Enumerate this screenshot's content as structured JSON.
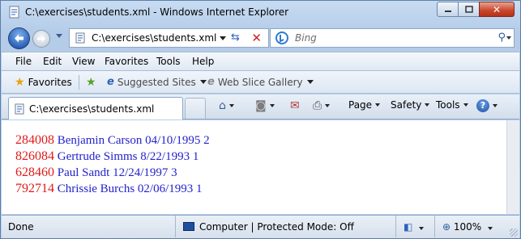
{
  "window": {
    "title": "C:\\exercises\\students.xml - Windows Internet Explorer",
    "controls": {
      "close_glyph": "✕"
    }
  },
  "navigation": {
    "address": "C:\\exercises\\students.xml",
    "search_placeholder": "Bing",
    "refresh_glyph": "⇆",
    "stop_glyph": "✕"
  },
  "menu": {
    "items": [
      "File",
      "Edit",
      "View",
      "Favorites",
      "Tools",
      "Help"
    ]
  },
  "favorites_bar": {
    "favorites_label": "Favorites",
    "suggested_sites": "Suggested Sites",
    "web_slice_gallery": "Web Slice Gallery"
  },
  "tab": {
    "label": "C:\\exercises\\students.xml"
  },
  "command_bar": {
    "page": "Page",
    "safety": "Safety",
    "tools": "Tools",
    "help_glyph": "?"
  },
  "students": [
    {
      "id": "284008",
      "details": "Benjamin Carson 04/10/1995 2"
    },
    {
      "id": "826084",
      "details": "Gertrude Simms 8/22/1993 1"
    },
    {
      "id": "628460",
      "details": "Paul Sandt 12/24/1997 3"
    },
    {
      "id": "792714",
      "details": "Chrissie Burchs 02/06/1993 1"
    }
  ],
  "status": {
    "text": "Done",
    "zone": "Computer | Protected Mode: Off",
    "zoom": "100%"
  },
  "colors": {
    "student_id": "#e21a1a",
    "student_details": "#2222cc"
  }
}
